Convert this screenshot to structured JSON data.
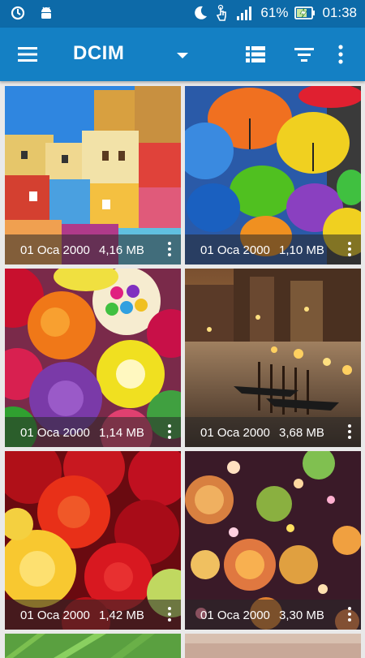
{
  "status_bar": {
    "battery": "61%",
    "time": "01:38",
    "icons": [
      "sync-icon",
      "android-icon",
      "moon-icon",
      "touch-icon",
      "signal-icon",
      "battery-charging-icon"
    ]
  },
  "app_bar": {
    "title": "DCIM",
    "icons": [
      "menu-icon",
      "dropdown-icon",
      "list-view-icon",
      "filter-icon",
      "more-vert-icon"
    ]
  },
  "gallery": {
    "items": [
      {
        "date": "01 Oca 2000",
        "size": "4,16 MB",
        "subject": "colorful-houses"
      },
      {
        "date": "01 Oca 2000",
        "size": "1,10 MB",
        "subject": "umbrellas"
      },
      {
        "date": "01 Oca 2000",
        "size": "1,14 MB",
        "subject": "cupcakes"
      },
      {
        "date": "01 Oca 2000",
        "size": "3,68 MB",
        "subject": "venice-night"
      },
      {
        "date": "01 Oca 2000",
        "size": "1,42 MB",
        "subject": "roses"
      },
      {
        "date": "01 Oca 2000",
        "size": "3,30 MB",
        "subject": "lanterns"
      }
    ]
  }
}
